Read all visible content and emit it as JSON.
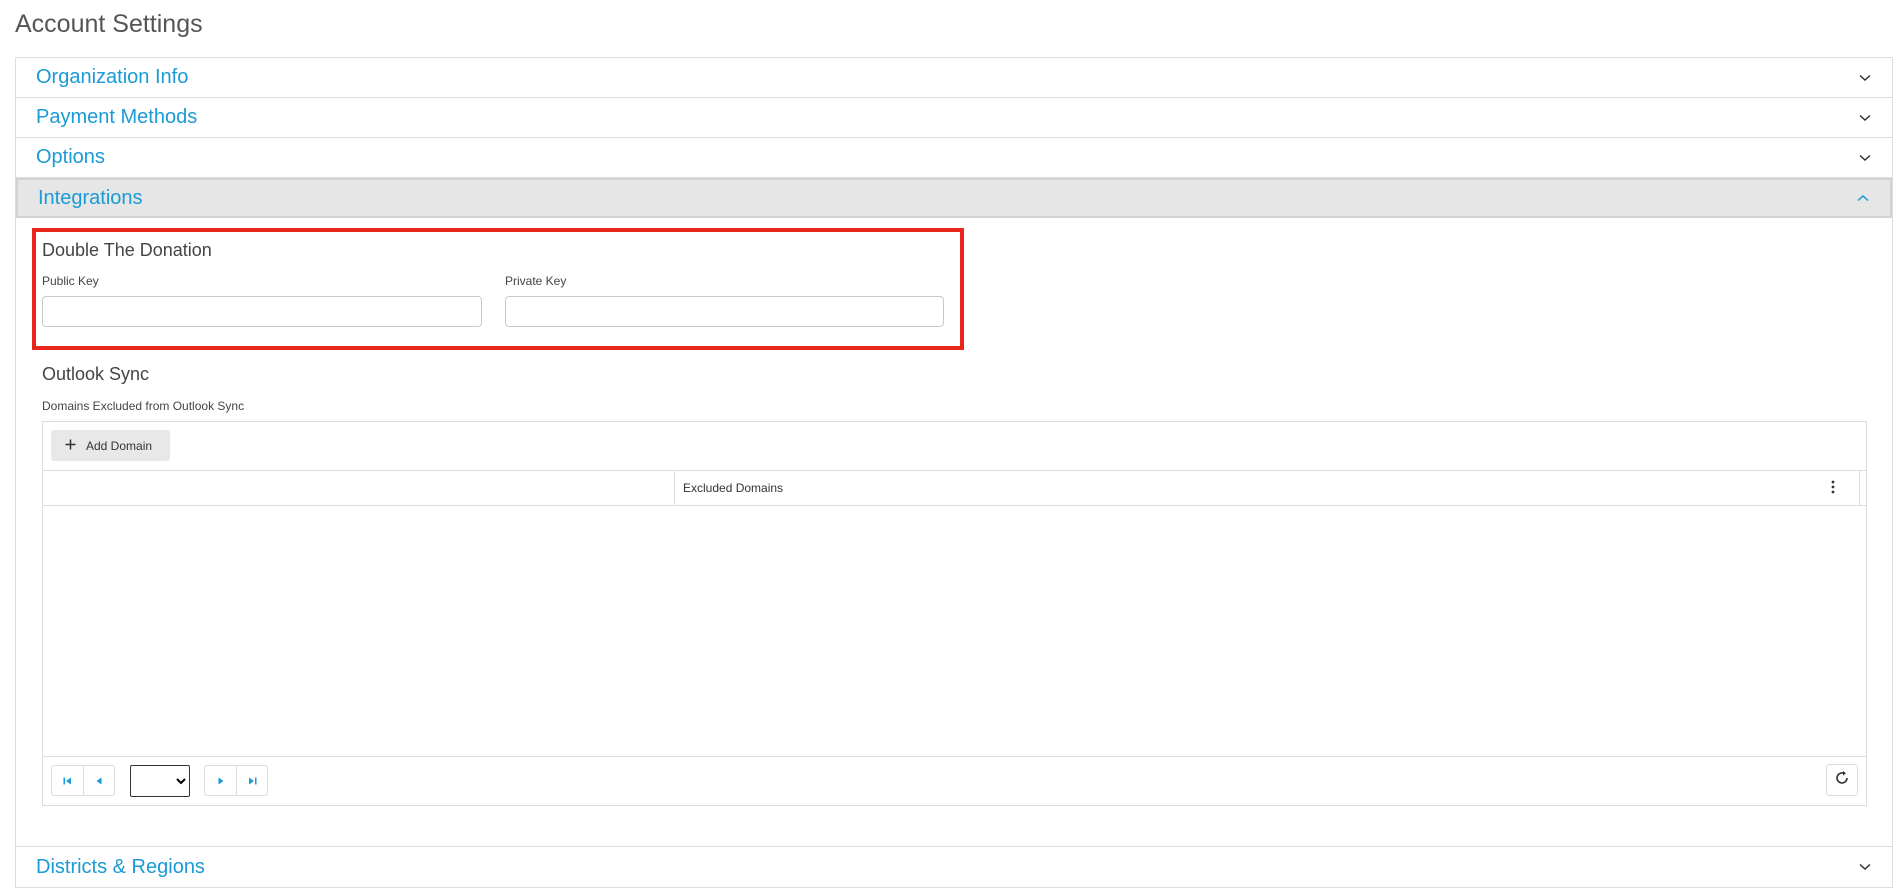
{
  "page": {
    "title": "Account Settings"
  },
  "accordion": {
    "sections": [
      {
        "label": "Organization Info",
        "expanded": false,
        "icon": "chevron-down-icon"
      },
      {
        "label": "Payment Methods",
        "expanded": false,
        "icon": "chevron-down-icon"
      },
      {
        "label": "Options",
        "expanded": false,
        "icon": "chevron-down-icon"
      },
      {
        "label": "Integrations",
        "expanded": true,
        "icon": "chevron-up-icon"
      },
      {
        "label": "Districts & Regions",
        "expanded": false,
        "icon": "chevron-down-icon"
      }
    ]
  },
  "integrations": {
    "double_the_donation": {
      "title": "Double The Donation",
      "public_key_label": "Public Key",
      "public_key_value": "",
      "private_key_label": "Private Key",
      "private_key_value": ""
    },
    "outlook_sync": {
      "title": "Outlook Sync",
      "excluded_label": "Domains Excluded from Outlook Sync",
      "add_button_label": "Add Domain",
      "column_header": "Excluded Domains",
      "page_select_value": ""
    }
  },
  "colors": {
    "accent": "#1a9ad6",
    "highlight_border": "#e8261b",
    "active_header_bg": "#e6e6e6"
  }
}
